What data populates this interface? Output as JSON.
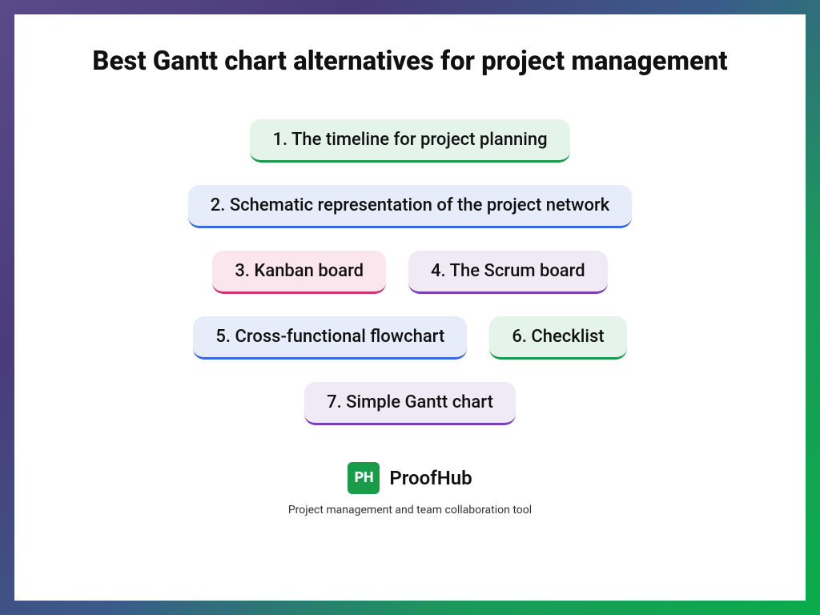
{
  "title": "Best Gantt chart alternatives for project management",
  "items": [
    {
      "label": "1. The timeline for project planning",
      "variant": "green"
    },
    {
      "label": "2. Schematic representation of the project network",
      "variant": "blue"
    },
    {
      "label": "3. Kanban board",
      "variant": "pink"
    },
    {
      "label": "4. The Scrum board",
      "variant": "purple"
    },
    {
      "label": "5. Cross-functional flowchart",
      "variant": "blue"
    },
    {
      "label": "6. Checklist",
      "variant": "green"
    },
    {
      "label": "7. Simple Gantt chart",
      "variant": "purple"
    }
  ],
  "brand": {
    "badge": "PH",
    "name": "ProofHub",
    "tagline": "Project management and team collaboration tool"
  }
}
